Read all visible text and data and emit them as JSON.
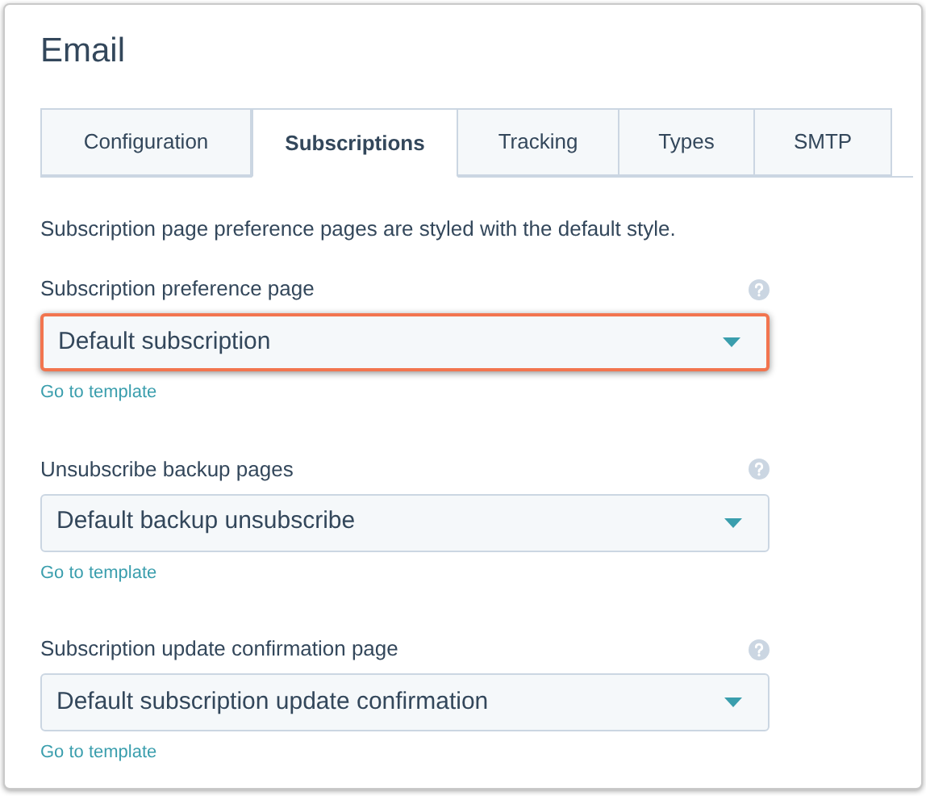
{
  "title": "Email",
  "tabs": [
    {
      "label": "Configuration",
      "selected": false
    },
    {
      "label": "Subscriptions",
      "selected": true
    },
    {
      "label": "Tracking",
      "selected": false
    },
    {
      "label": "Types",
      "selected": false
    },
    {
      "label": "SMTP",
      "selected": false
    }
  ],
  "description": "Subscription page preference pages are styled with the default style.",
  "fields": [
    {
      "label": "Subscription preference page",
      "value": "Default subscription",
      "highlighted": true,
      "link": "Go to template"
    },
    {
      "label": "Unsubscribe backup pages",
      "value": "Default backup unsubscribe",
      "highlighted": false,
      "link": "Go to template"
    },
    {
      "label": "Subscription update confirmation page",
      "value": "Default subscription update confirmation",
      "highlighted": false,
      "link": "Go to template"
    }
  ]
}
